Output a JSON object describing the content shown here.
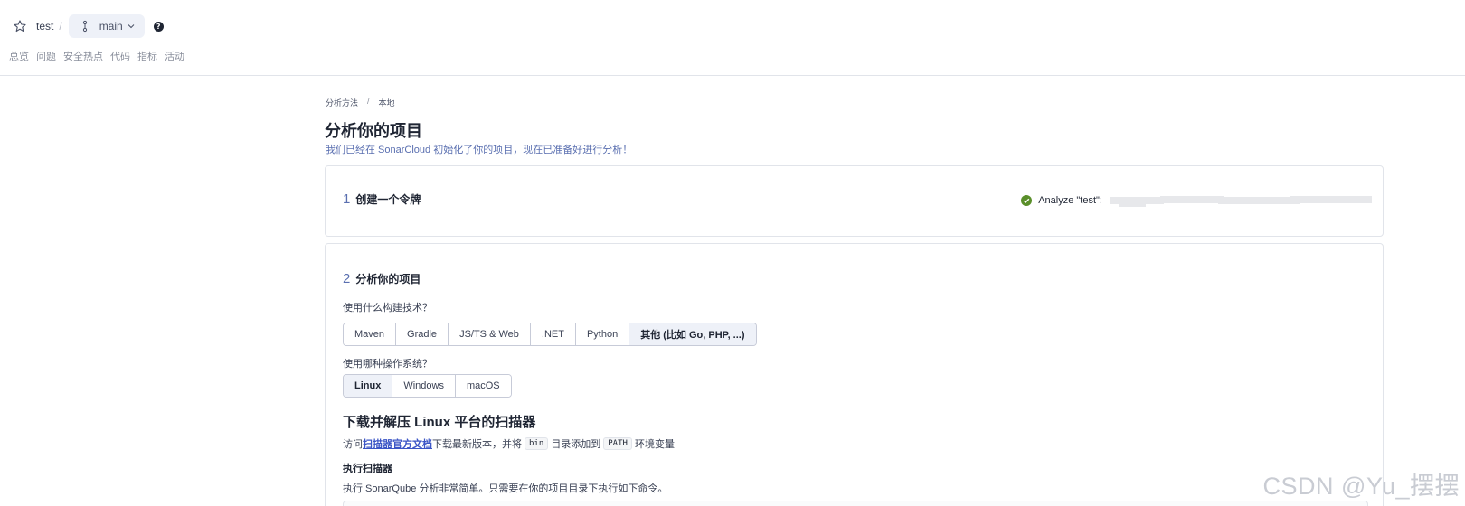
{
  "header": {
    "project_name": "test",
    "separator": "/",
    "branch_name": "main",
    "help_label": "?",
    "nav": [
      "总览",
      "问题",
      "安全热点",
      "代码",
      "指标",
      "活动"
    ]
  },
  "breadcrumb": {
    "items": [
      "分析方法",
      "本地"
    ],
    "separator": "/"
  },
  "page": {
    "title": "分析你的项目",
    "subtitle": "我们已经在 SonarCloud 初始化了你的项目，现在已准备好进行分析！"
  },
  "step1": {
    "number": "1",
    "title": "创建一个令牌",
    "status_text": "Analyze \"test\":"
  },
  "step2": {
    "number": "2",
    "title": "分析你的项目",
    "build_question": "使用什么构建技术？",
    "build_options": [
      "Maven",
      "Gradle",
      "JS/TS & Web",
      ".NET",
      "Python",
      "其他 (比如 Go, PHP, ...)"
    ],
    "build_selected": "其他 (比如 Go, PHP, ...)",
    "os_question": "使用哪种操作系统？",
    "os_options": [
      "Linux",
      "Windows",
      "macOS"
    ],
    "os_selected": "Linux",
    "download_title": "下载并解压 Linux 平台的扫描器",
    "visit_prefix": "访问",
    "visit_link": "扫描器官方文档",
    "visit_mid": "下载最新版本，并将",
    "code_bin": "bin",
    "visit_mid2": "目录添加到",
    "code_path": "PATH",
    "visit_suffix": "环境变量",
    "exec_title": "执行扫描器",
    "exec_desc": "执行 SonarQube 分析非常简单。只需要在你的项目目录下执行如下命令。"
  },
  "watermark": "CSDN @Yu_摆摆",
  "colors": {
    "accent": "#5a6fb0",
    "link": "#3b55c6",
    "success": "#5a8f2a",
    "selected_bg": "#eef1f8"
  }
}
